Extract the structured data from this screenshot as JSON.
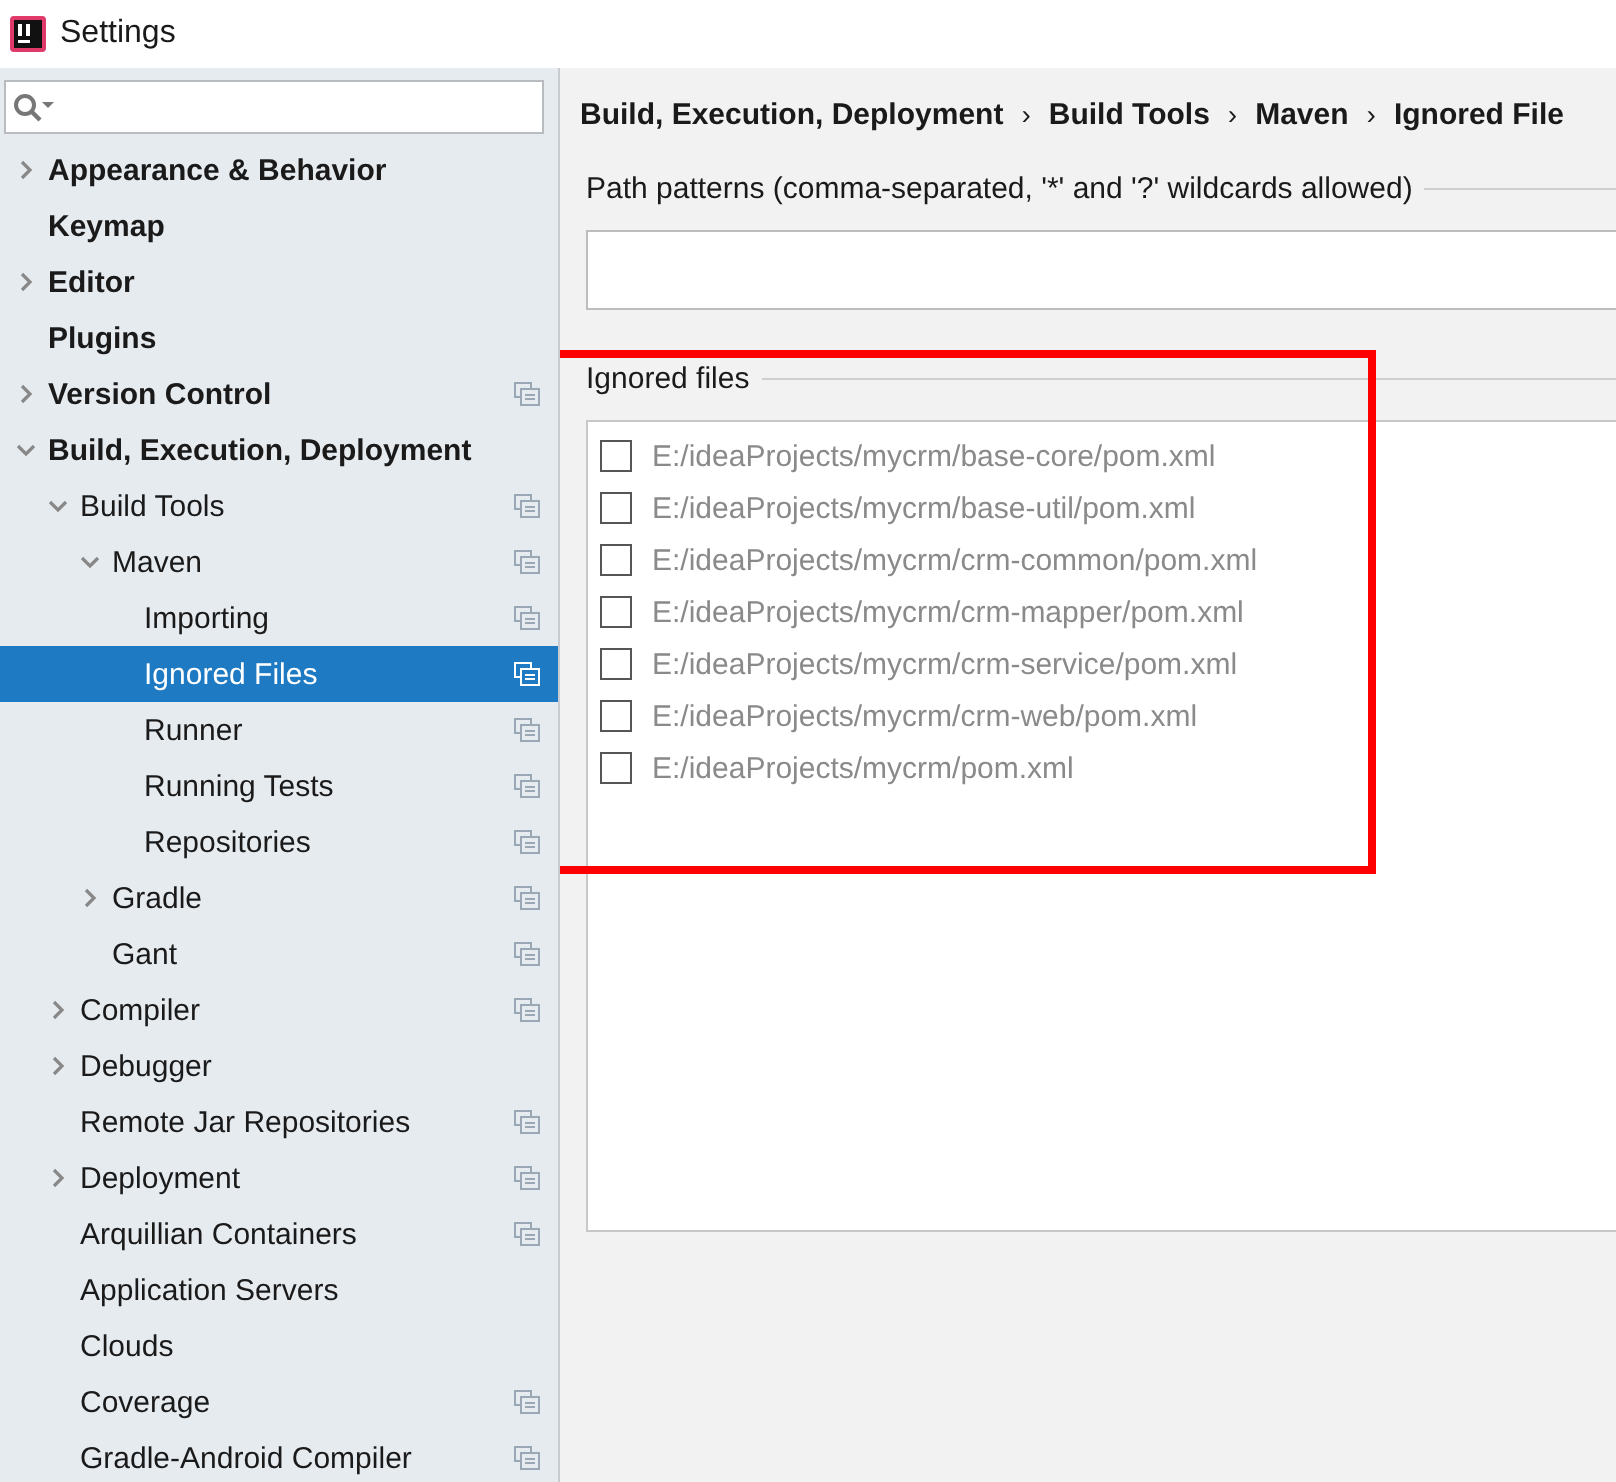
{
  "window": {
    "title": "Settings"
  },
  "sidebar": {
    "tree": [
      {
        "label": "Appearance & Behavior",
        "expanded": false,
        "project_scope": false,
        "selected": false
      },
      {
        "label": "Keymap",
        "project_scope": false,
        "selected": false
      },
      {
        "label": "Editor",
        "expanded": false,
        "project_scope": false,
        "selected": false
      },
      {
        "label": "Plugins",
        "project_scope": false,
        "selected": false
      },
      {
        "label": "Version Control",
        "expanded": false,
        "project_scope": true,
        "selected": false
      },
      {
        "label": "Build, Execution, Deployment",
        "expanded": true,
        "project_scope": false,
        "selected": false,
        "children": [
          {
            "label": "Build Tools",
            "expanded": true,
            "project_scope": true,
            "selected": false,
            "children": [
              {
                "label": "Maven",
                "expanded": true,
                "project_scope": true,
                "selected": false,
                "children": [
                  {
                    "label": "Importing",
                    "project_scope": true,
                    "selected": false
                  },
                  {
                    "label": "Ignored Files",
                    "project_scope": true,
                    "selected": true
                  },
                  {
                    "label": "Runner",
                    "project_scope": true,
                    "selected": false
                  },
                  {
                    "label": "Running Tests",
                    "project_scope": true,
                    "selected": false
                  },
                  {
                    "label": "Repositories",
                    "project_scope": true,
                    "selected": false
                  }
                ]
              },
              {
                "label": "Gradle",
                "expanded": false,
                "project_scope": true,
                "selected": false
              },
              {
                "label": "Gant",
                "project_scope": true,
                "selected": false
              }
            ]
          },
          {
            "label": "Compiler",
            "expanded": false,
            "project_scope": true,
            "selected": false
          },
          {
            "label": "Debugger",
            "expanded": false,
            "project_scope": false,
            "selected": false
          },
          {
            "label": "Remote Jar Repositories",
            "project_scope": true,
            "selected": false
          },
          {
            "label": "Deployment",
            "expanded": false,
            "project_scope": true,
            "selected": false
          },
          {
            "label": "Arquillian Containers",
            "project_scope": true,
            "selected": false
          },
          {
            "label": "Application Servers",
            "project_scope": false,
            "selected": false
          },
          {
            "label": "Clouds",
            "project_scope": false,
            "selected": false
          },
          {
            "label": "Coverage",
            "project_scope": true,
            "selected": false
          },
          {
            "label": "Gradle-Android Compiler",
            "project_scope": true,
            "selected": false
          }
        ]
      }
    ]
  },
  "breadcrumb": {
    "separator": "›",
    "items": [
      "Build, Execution, Deployment",
      "Build Tools",
      "Maven",
      "Ignored File"
    ]
  },
  "path_patterns": {
    "label": "Path patterns (comma-separated, '*' and '?' wildcards allowed)"
  },
  "ignored_files": {
    "label": "Ignored files",
    "files": [
      {
        "path": "E:/ideaProjects/mycrm/base-core/pom.xml",
        "checked": false
      },
      {
        "path": "E:/ideaProjects/mycrm/base-util/pom.xml",
        "checked": false
      },
      {
        "path": "E:/ideaProjects/mycrm/crm-common/pom.xml",
        "checked": false
      },
      {
        "path": "E:/ideaProjects/mycrm/crm-mapper/pom.xml",
        "checked": false
      },
      {
        "path": "E:/ideaProjects/mycrm/crm-service/pom.xml",
        "checked": false
      },
      {
        "path": "E:/ideaProjects/mycrm/crm-web/pom.xml",
        "checked": false
      },
      {
        "path": "E:/ideaProjects/mycrm/pom.xml",
        "checked": false
      }
    ]
  }
}
